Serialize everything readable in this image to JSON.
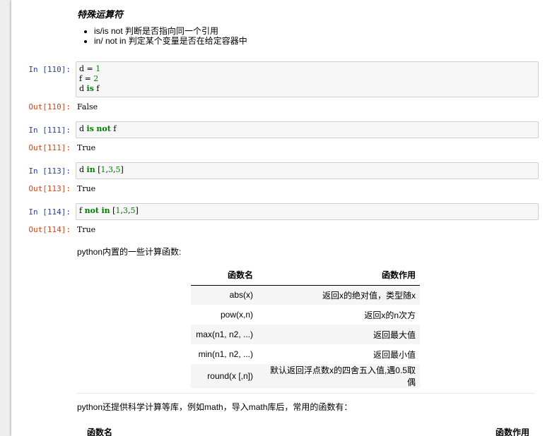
{
  "md1": {
    "title": "特殊运算符",
    "bullets": [
      "is/is not 判断是否指向同一个引用",
      "in/ not in 判定某个变量是否在给定容器中"
    ]
  },
  "cells": [
    {
      "in_prompt": "In  [110]:",
      "code": [
        [
          {
            "t": "d = ",
            "c": ""
          },
          {
            "t": "1",
            "c": "num"
          }
        ],
        [
          {
            "t": "f = ",
            "c": ""
          },
          {
            "t": "2",
            "c": "num"
          }
        ],
        [
          {
            "t": "d ",
            "c": ""
          },
          {
            "t": "is",
            "c": "kw"
          },
          {
            "t": " f",
            "c": ""
          }
        ]
      ],
      "out_prompt": "Out[110]:",
      "output": "False"
    },
    {
      "in_prompt": "In  [111]:",
      "code": [
        [
          {
            "t": "d ",
            "c": ""
          },
          {
            "t": "is",
            "c": "kw"
          },
          {
            "t": " ",
            "c": ""
          },
          {
            "t": "not",
            "c": "kw"
          },
          {
            "t": " f",
            "c": ""
          }
        ]
      ],
      "out_prompt": "Out[111]:",
      "output": "True"
    },
    {
      "in_prompt": "In  [113]:",
      "code": [
        [
          {
            "t": "d ",
            "c": ""
          },
          {
            "t": "in",
            "c": "kw"
          },
          {
            "t": " [",
            "c": ""
          },
          {
            "t": "1",
            "c": "num"
          },
          {
            "t": ",",
            "c": ""
          },
          {
            "t": "3",
            "c": "num"
          },
          {
            "t": ",",
            "c": ""
          },
          {
            "t": "5",
            "c": "num"
          },
          {
            "t": "]",
            "c": ""
          }
        ]
      ],
      "out_prompt": "Out[113]:",
      "output": "True"
    },
    {
      "in_prompt": "In  [114]:",
      "code": [
        [
          {
            "t": "f ",
            "c": ""
          },
          {
            "t": "not",
            "c": "kw"
          },
          {
            "t": " ",
            "c": ""
          },
          {
            "t": "in",
            "c": "kw"
          },
          {
            "t": " [",
            "c": ""
          },
          {
            "t": "1",
            "c": "num"
          },
          {
            "t": ",",
            "c": ""
          },
          {
            "t": "3",
            "c": "num"
          },
          {
            "t": ",",
            "c": ""
          },
          {
            "t": "5",
            "c": "num"
          },
          {
            "t": "]",
            "c": ""
          }
        ]
      ],
      "out_prompt": "Out[114]:",
      "output": "True"
    }
  ],
  "md2": {
    "intro": "python内置的一些计算函数:",
    "table": {
      "headers": [
        "函数名",
        "函数作用"
      ],
      "rows": [
        [
          "abs(x)",
          "返回x的绝对值，类型随x"
        ],
        [
          "pow(x,n)",
          "返回x的n次方"
        ],
        [
          "max(n1, n2, ...)",
          "返回最大值"
        ],
        [
          "min(n1, n2, ...)",
          "返回最小值"
        ],
        [
          "round(x [,n])",
          "默认返回浮点数x的四舍五入值,遇0.5取偶"
        ]
      ]
    }
  },
  "md3": {
    "intro": "python还提供科学计算等库，例如math，导入math库后，常用的函数有：",
    "headers": [
      "函数名",
      "函数作用"
    ]
  }
}
